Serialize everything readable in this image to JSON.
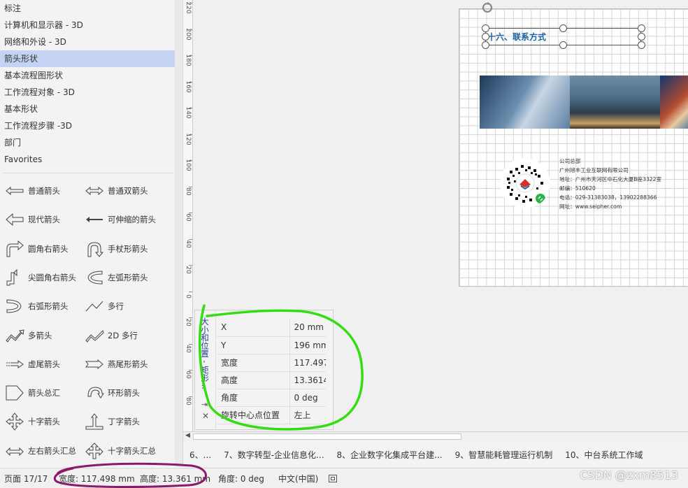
{
  "stencils": {
    "categories": [
      {
        "label": "标注",
        "selected": false
      },
      {
        "label": "计算机和显示器 - 3D",
        "selected": false
      },
      {
        "label": "网络和外设 - 3D",
        "selected": false
      },
      {
        "label": "箭头形状",
        "selected": true
      },
      {
        "label": "基本流程图形状",
        "selected": false
      },
      {
        "label": "工作流程对象 - 3D",
        "selected": false
      },
      {
        "label": "基本形状",
        "selected": false
      },
      {
        "label": "工作流程步骤 -3D",
        "selected": false
      },
      {
        "label": "部门",
        "selected": false
      },
      {
        "label": "Favorites",
        "selected": false
      }
    ],
    "shapes": [
      {
        "label": "普通箭头",
        "icon": "simple-arrow-icon"
      },
      {
        "label": "普通双箭头",
        "icon": "double-arrow-icon"
      },
      {
        "label": "现代箭头",
        "icon": "modern-arrow-icon"
      },
      {
        "label": "可伸缩的箭头",
        "icon": "flexible-arrow-icon"
      },
      {
        "label": "圆角右箭头",
        "icon": "rounded-right-arrow-icon"
      },
      {
        "label": "手杖形箭头",
        "icon": "cane-arrow-icon"
      },
      {
        "label": "尖圆角右箭头",
        "icon": "sharp-right-arrow-icon"
      },
      {
        "label": "左弧形箭头",
        "icon": "left-arc-arrow-icon"
      },
      {
        "label": "右弧形箭头",
        "icon": "right-arc-arrow-icon"
      },
      {
        "label": "多行",
        "icon": "multi-line-icon"
      },
      {
        "label": "多箭头",
        "icon": "multi-arrow-icon"
      },
      {
        "label": "2D 多行",
        "icon": "multi-line-2d-icon"
      },
      {
        "label": "虚尾箭头",
        "icon": "dashed-tail-arrow-icon"
      },
      {
        "label": "燕尾形箭头",
        "icon": "swallowtail-arrow-icon"
      },
      {
        "label": "箭头总汇",
        "icon": "arrow-pentagon-icon"
      },
      {
        "label": "环形箭头",
        "icon": "circular-arrow-icon"
      },
      {
        "label": "十字箭头",
        "icon": "cross-arrow-icon"
      },
      {
        "label": "丁字箭头",
        "icon": "t-arrow-icon"
      },
      {
        "label": "左右箭头汇总",
        "icon": "left-right-arrow-icon"
      },
      {
        "label": "十字箭头汇总",
        "icon": "cross-arrow-summary-icon"
      }
    ]
  },
  "ruler": {
    "labels": [
      "220",
      "200",
      "180",
      "160",
      "140",
      "120",
      "100",
      "80",
      "60",
      "40",
      "20",
      "0",
      "20",
      "40",
      "60",
      "80"
    ]
  },
  "canvas": {
    "title_text": "十六、联系方式",
    "company": {
      "line1": "公司总部",
      "line2": "广州旭丰工业互联网有限公司",
      "line3": "地址：广州市天河区中石化大厦B座3322室",
      "line4": "邮编：510620",
      "line5": "电话：029-31383038，13902288366",
      "line6": "网址：www.seipher.com"
    }
  },
  "size_panel": {
    "title": "大小和位置 - 矩形...",
    "rows": [
      {
        "label": "X",
        "value": "20 mm"
      },
      {
        "label": "Y",
        "value": "196 mm"
      },
      {
        "label": "宽度",
        "value": "117.497"
      },
      {
        "label": "高度",
        "value": "13.3614"
      },
      {
        "label": "角度",
        "value": "0 deg"
      },
      {
        "label": "旋转中心点位置",
        "value": "左上"
      }
    ]
  },
  "page_tabs": [
    {
      "label": "6、..."
    },
    {
      "label": "7、数字转型-企业信息化..."
    },
    {
      "label": "8、企业数字化集成平台建..."
    },
    {
      "label": "9、智慧能耗管理运行机制"
    },
    {
      "label": "10、中台系统工作域"
    }
  ],
  "status": {
    "page": "页面 17/17",
    "width": "宽度: 117.498 mm",
    "height": "高度: 13.361 mm",
    "angle": "角度: 0 deg",
    "language": "中文(中国)"
  },
  "watermark": "CSDN @zxm8513",
  "colors": {
    "selected_stencil": "#c5d3f2",
    "title_text": "#1a63a8",
    "annotation_green": "#33dd11",
    "annotation_purple": "#8b1a6b"
  }
}
